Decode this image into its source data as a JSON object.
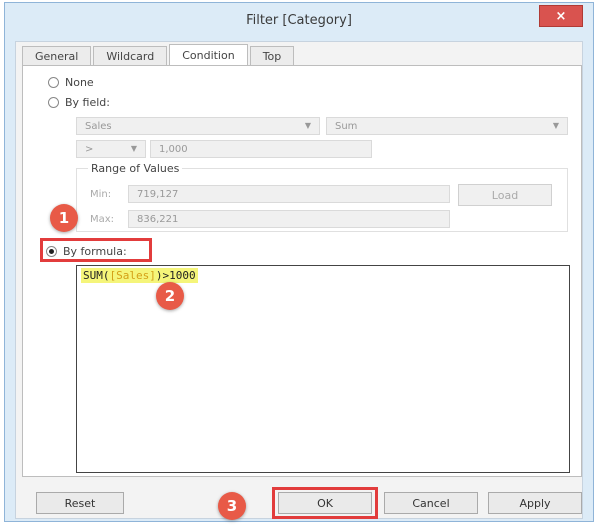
{
  "window": {
    "title": "Filter [Category]",
    "close_label": "×"
  },
  "tabs": [
    {
      "label": "General"
    },
    {
      "label": "Wildcard"
    },
    {
      "label": "Condition"
    },
    {
      "label": "Top"
    }
  ],
  "condition": {
    "none_label": "None",
    "by_field_label": "By field:",
    "field": "Sales",
    "aggregation": "Sum",
    "operator": ">",
    "value": "1,000",
    "range": {
      "label": "Range of Values",
      "min_label": "Min:",
      "min_value": "719,127",
      "max_label": "Max:",
      "max_value": "836,221",
      "load_label": "Load"
    },
    "by_formula_label": "By formula:",
    "formula": {
      "fn": "SUM(",
      "field": "[Sales]",
      "rest": ")>1000"
    }
  },
  "buttons": {
    "reset": "Reset",
    "ok": "OK",
    "cancel": "Cancel",
    "apply": "Apply"
  },
  "callouts": {
    "one": "1",
    "two": "2",
    "three": "3"
  },
  "colors": {
    "callout": "#e23c3c",
    "badge": "#e85a47",
    "formula_highlight": "#f5f57a"
  }
}
